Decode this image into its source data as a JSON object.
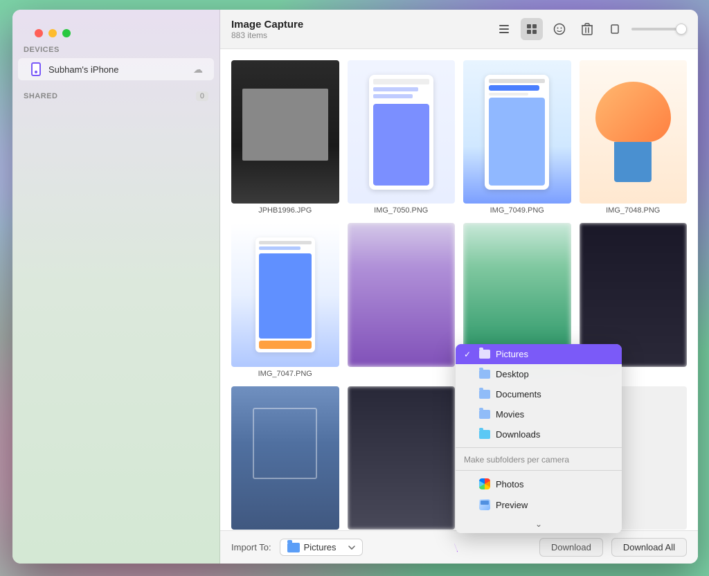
{
  "desktop": {
    "bg_color": "#7dd3a8"
  },
  "window": {
    "title": "Image Capture",
    "item_count": "883 items"
  },
  "toolbar": {
    "list_view_label": "List view",
    "grid_view_label": "Grid view",
    "emoji_label": "Emoji",
    "delete_label": "Delete",
    "rotate_label": "Rotate"
  },
  "sidebar": {
    "devices_label": "DEVICES",
    "shared_label": "SHARED",
    "shared_count": "0",
    "device_name": "Subham's iPhone"
  },
  "images": [
    {
      "id": "JPHB1996.JPG",
      "style": "laptop"
    },
    {
      "id": "IMG_7050.PNG",
      "style": "phone-app"
    },
    {
      "id": "IMG_7049.PNG",
      "style": "phone-app2"
    },
    {
      "id": "IMG_7048.PNG",
      "style": "illustration"
    },
    {
      "id": "IMG_7047.PNG",
      "style": "phone-blue"
    },
    {
      "id": "",
      "style": "person1"
    },
    {
      "id": "",
      "style": "person2"
    },
    {
      "id": "",
      "style": "dark"
    },
    {
      "id": "",
      "style": "building"
    },
    {
      "id": "",
      "style": "chat"
    },
    {
      "id": "",
      "style": "table"
    },
    {
      "id": "",
      "style": "empty"
    }
  ],
  "bottom_bar": {
    "import_to_label": "Import To:",
    "download_label": "Download",
    "download_all_label": "Download All"
  },
  "dropdown": {
    "items": [
      {
        "label": "Pictures",
        "type": "folder-blue",
        "selected": true
      },
      {
        "label": "Desktop",
        "type": "folder-light",
        "selected": false
      },
      {
        "label": "Documents",
        "type": "folder-light",
        "selected": false
      },
      {
        "label": "Movies",
        "type": "folder-light",
        "selected": false
      },
      {
        "label": "Downloads",
        "type": "folder-light-teal",
        "selected": false
      }
    ],
    "section_label": "Make subfolders per camera",
    "app_items": [
      {
        "label": "Photos",
        "type": "photos"
      },
      {
        "label": "Preview",
        "type": "preview"
      }
    ],
    "chevron": "⌄"
  }
}
